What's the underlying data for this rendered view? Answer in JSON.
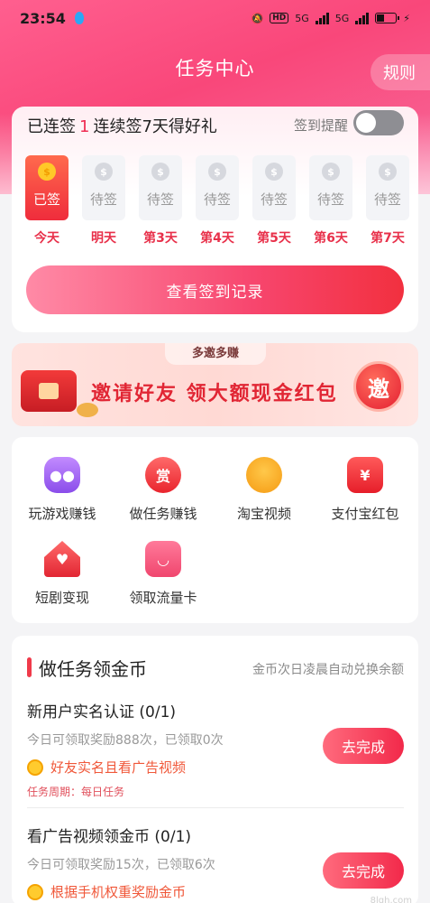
{
  "status_bar": {
    "time": "23:54",
    "network_1": "5G",
    "network_2": "5G",
    "hd": "HD"
  },
  "header": {
    "title": "任务中心",
    "rules": "规则"
  },
  "signin": {
    "streak_prefix": "已连签",
    "streak_count": "1",
    "streak_suffix": "连续签7天得好礼",
    "remind_label": "签到提醒",
    "remind_on": false,
    "coin_symbol": "$",
    "days": [
      {
        "status": "已签",
        "label": "今天",
        "done": true
      },
      {
        "status": "待签",
        "label": "明天",
        "done": false
      },
      {
        "status": "待签",
        "label": "第3天",
        "done": false
      },
      {
        "status": "待签",
        "label": "第4天",
        "done": false
      },
      {
        "status": "待签",
        "label": "第5天",
        "done": false
      },
      {
        "status": "待签",
        "label": "第6天",
        "done": false
      },
      {
        "status": "待签",
        "label": "第7天",
        "done": false
      }
    ],
    "record_button": "查看签到记录"
  },
  "invite": {
    "tab": "多邀多赚",
    "title": "邀请好友 领大额现金红包",
    "badge": "邀"
  },
  "shortcuts": {
    "items": [
      {
        "label": "玩游戏赚钱",
        "icon": "gamepad-icon"
      },
      {
        "label": "做任务赚钱",
        "icon": "reward-icon",
        "glyph": "赏"
      },
      {
        "label": "淘宝视频",
        "icon": "taobao-icon"
      },
      {
        "label": "支付宝红包",
        "icon": "alipay-redpacket-icon",
        "glyph": "¥"
      },
      {
        "label": "短剧变现",
        "icon": "house-heart-icon"
      },
      {
        "label": "领取流量卡",
        "icon": "sim-card-icon"
      }
    ]
  },
  "tasks": {
    "title": "做任务领金币",
    "note": "金币次日凌晨自动兑换余额",
    "items": [
      {
        "title": "新用户实名认证 (0/1)",
        "sub": "今日可领取奖励888次，已领取0次",
        "hint": "好友实名且看广告视频",
        "cycle": "任务周期：每日任务",
        "button": "去完成"
      },
      {
        "title": "看广告视频领金币 (0/1)",
        "sub": "今日可领取奖励15次，已领取6次",
        "hint": "根据手机权重奖励金币",
        "button": "去完成"
      }
    ]
  },
  "watermark": "8lgh.com",
  "colors": {
    "accent": "#f7466e",
    "brand_red": "#ef2c52"
  }
}
